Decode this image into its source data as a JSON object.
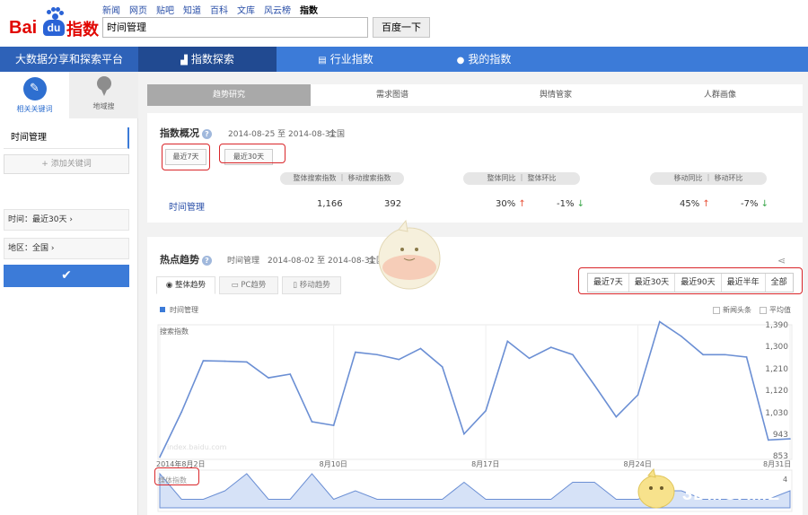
{
  "header": {
    "logo_text": "Bai度指数",
    "nav_links": [
      "新闻",
      "网页",
      "贴吧",
      "知道",
      "百科",
      "文库",
      "风云榜",
      "指数"
    ],
    "active_nav": "指数",
    "search_value": "时间管理",
    "search_button": "百度一下"
  },
  "bluebar": {
    "slogan": "大数据分享和探索平台",
    "tabs": [
      {
        "label": "指数探索",
        "icon": "bar-chart-icon"
      },
      {
        "label": "行业指数",
        "icon": "grid-icon"
      },
      {
        "label": "我的指数",
        "icon": "user-icon"
      }
    ]
  },
  "sidebar": {
    "tab_keywords": "相关关键词",
    "tab_region": "地域搜",
    "keyword": "时间管理",
    "add_keyword": "+ 添加关键词",
    "time_option": "时间：最近30天 ›",
    "region_option": "地区：全国 ›",
    "confirm_icon": "check-icon"
  },
  "subtabs": [
    "趋势研究",
    "需求图谱",
    "舆情管家",
    "人群画像"
  ],
  "overview": {
    "title": "指数概况",
    "date_range": "2014-08-25 至 2014-08-31",
    "region": "全国",
    "range_7": "最近7天",
    "range_30": "最近30天",
    "col_group1": "整体搜索指数 ｜ 移动搜索指数",
    "col_group2": "整体同比 ｜ 整体环比",
    "col_group3": "移动同比 ｜ 移动环比",
    "row_keyword": "时间管理",
    "overall_index": "1,166",
    "mobile_index": "392",
    "overall_yoy": "30%",
    "overall_mom": "-1%",
    "mobile_yoy": "45%",
    "mobile_mom": "-7%"
  },
  "trend": {
    "title": "热点趋势",
    "keyword": "时间管理",
    "date_range": "2014-08-02 至 2014-08-31",
    "region": "全国",
    "tabs": [
      "整体趋势",
      "PC趋势",
      "移动趋势"
    ],
    "ranges": [
      "最近7天",
      "最近30天",
      "最近90天",
      "最近半年",
      "全部"
    ],
    "legend_series": "时间管理",
    "opt_news": "新闻头条",
    "opt_avg": "平均值",
    "y_label": "搜索指数",
    "media_label": "媒体指数",
    "media_tick": "4",
    "watermark_url": "index.baidu.com"
  },
  "chart_data": {
    "type": "line",
    "title": "",
    "xlabel": "",
    "ylabel": "搜索指数",
    "x_ticks": [
      "2014年8月2日",
      "8月10日",
      "8月17日",
      "8月24日",
      "8月31日"
    ],
    "y_ticks": [
      853,
      943,
      1030,
      1120,
      1210,
      1300,
      1390
    ],
    "ylim": [
      853,
      1390
    ],
    "series": [
      {
        "name": "时间管理",
        "color": "#6b8fd4",
        "values": [
          855,
          1040,
          1250,
          1248,
          1245,
          1180,
          1195,
          1000,
          985,
          1285,
          1275,
          1255,
          1300,
          1225,
          950,
          1045,
          1330,
          1260,
          1305,
          1275,
          1150,
          1020,
          1110,
          1410,
          1350,
          1275,
          1275,
          1265,
          925,
          930
        ]
      }
    ],
    "media": {
      "values": [
        4,
        1,
        1,
        2,
        4,
        1,
        1,
        4,
        1,
        2,
        1,
        1,
        1,
        1,
        3,
        1,
        1,
        1,
        1,
        3,
        3,
        1,
        1,
        2,
        2,
        1,
        1,
        1,
        1,
        2
      ],
      "ymax": 4
    },
    "grid": true,
    "legend_position": "top-left"
  },
  "colors": {
    "accent": "#3c7bd8",
    "dark_accent": "#214a91",
    "line": "#6b8fd4",
    "highlight_box": "#d9262a"
  }
}
